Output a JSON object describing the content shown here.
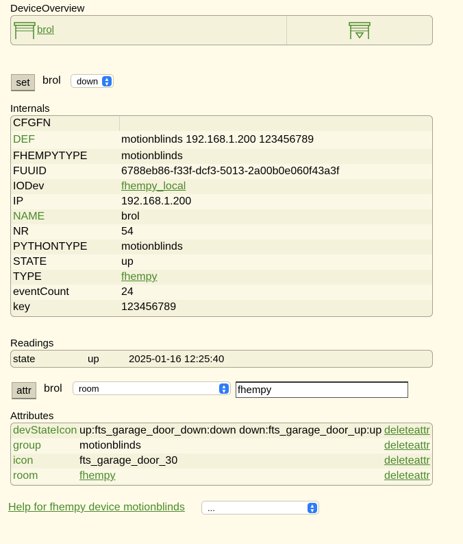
{
  "device_overview": {
    "title": "DeviceOverview",
    "device_link": "brol",
    "device_icon": "garage-door-icon",
    "state_icon": "garage-door-down-icon"
  },
  "set_cmd": {
    "button": "set",
    "device": "brol",
    "selected": "down"
  },
  "internals": {
    "title": "Internals",
    "rows": [
      {
        "name": "CFGFN",
        "value": ""
      },
      {
        "name": "DEF",
        "value": "motionblinds 192.168.1.200 123456789"
      },
      {
        "name": "FHEMPYTYPE",
        "value": "motionblinds"
      },
      {
        "name": "FUUID",
        "value": "6788eb86-f33f-dcf3-5013-2a00b0e060f43a3f"
      },
      {
        "name": "IODev",
        "value": "fhempy_local"
      },
      {
        "name": "IP",
        "value": "192.168.1.200"
      },
      {
        "name": "NAME",
        "value": "brol"
      },
      {
        "name": "NR",
        "value": "54"
      },
      {
        "name": "PYTHONTYPE",
        "value": "motionblinds"
      },
      {
        "name": "STATE",
        "value": "up"
      },
      {
        "name": "TYPE",
        "value": "fhempy"
      },
      {
        "name": "eventCount",
        "value": "24"
      },
      {
        "name": "key",
        "value": "123456789"
      }
    ]
  },
  "readings": {
    "title": "Readings",
    "rows": [
      {
        "name": "state",
        "value": "up",
        "time": "2025-01-16 12:25:40"
      }
    ]
  },
  "attr_cmd": {
    "button": "attr",
    "device": "brol",
    "selected": "room",
    "value": "fhempy"
  },
  "attributes": {
    "title": "Attributes",
    "delete_label": "deleteattr",
    "rows": [
      {
        "name": "devStateIcon",
        "value": "up:fts_garage_door_down:down down:fts_garage_door_up:up"
      },
      {
        "name": "group",
        "value": "motionblinds"
      },
      {
        "name": "icon",
        "value": "fts_garage_door_30"
      },
      {
        "name": "room",
        "value": "fhempy"
      }
    ]
  },
  "help": {
    "link": "Help for fhempy device motionblinds",
    "select": "..."
  }
}
